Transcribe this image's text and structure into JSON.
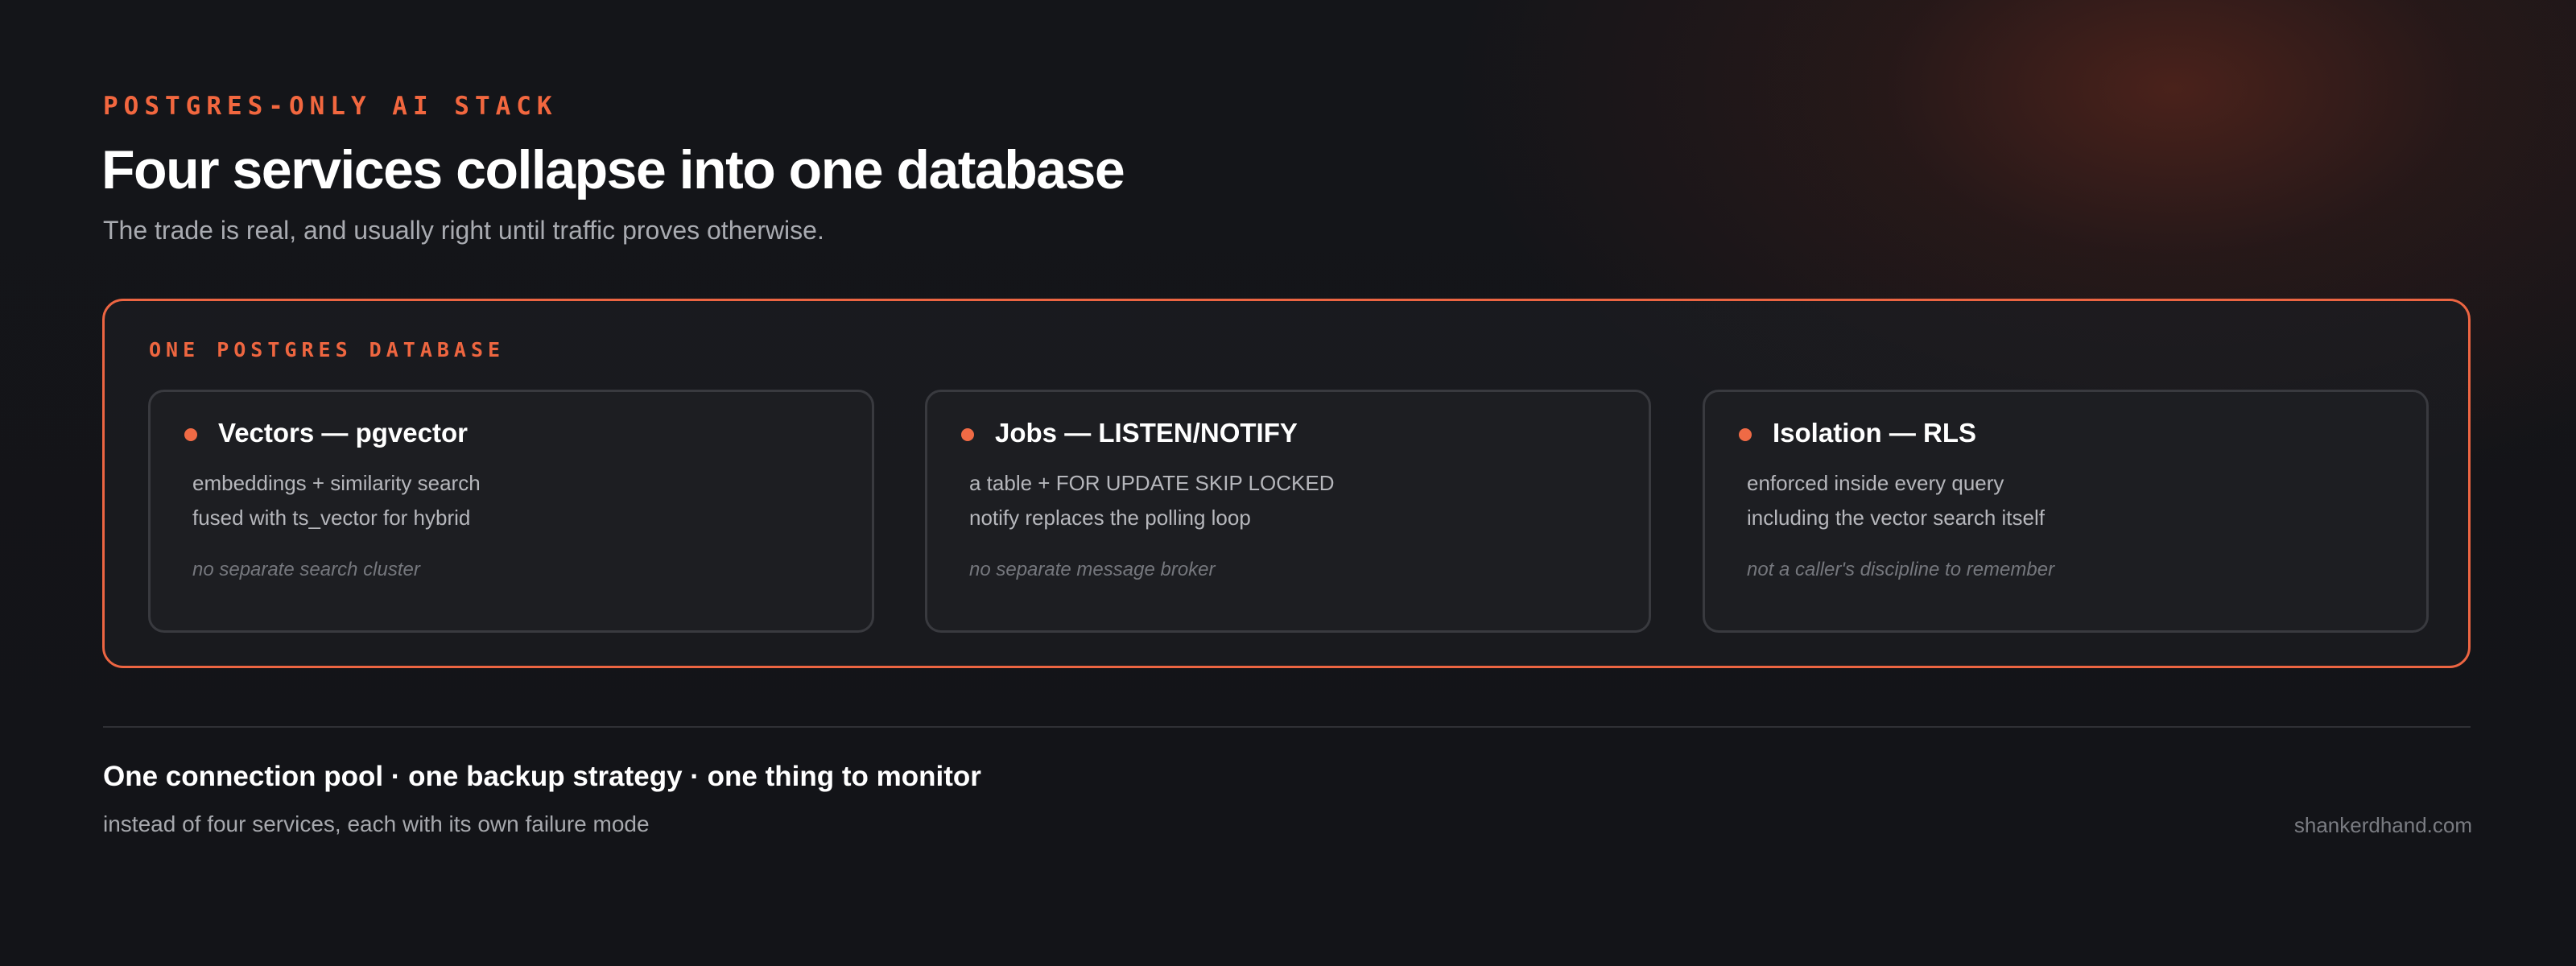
{
  "header": {
    "kicker": "POSTGRES-ONLY AI STACK",
    "title": "Four services collapse into one database",
    "subtitle": "The trade is real, and usually right until traffic proves otherwise."
  },
  "database": {
    "label": "ONE POSTGRES DATABASE",
    "cards": [
      {
        "title": "Vectors — pgvector",
        "lines": [
          "embeddings + similarity search",
          "fused with ts_vector for hybrid"
        ],
        "note": "no separate search cluster"
      },
      {
        "title": "Jobs — LISTEN/NOTIFY",
        "lines": [
          "a table + FOR UPDATE SKIP LOCKED",
          "notify replaces the polling loop"
        ],
        "note": "no separate message broker"
      },
      {
        "title": "Isolation — RLS",
        "lines": [
          "enforced inside every query",
          "including the vector search itself"
        ],
        "note": "not a caller's discipline to remember"
      }
    ]
  },
  "footer": {
    "title": "One connection pool · one backup strategy · one thing to monitor",
    "subtitle": "instead of four services, each with its own failure mode",
    "site": "shankerdhand.com"
  },
  "colors": {
    "accent": "#ef6a45",
    "background": "#131418",
    "card": "#1d1e22",
    "card_border": "#393a3f"
  }
}
